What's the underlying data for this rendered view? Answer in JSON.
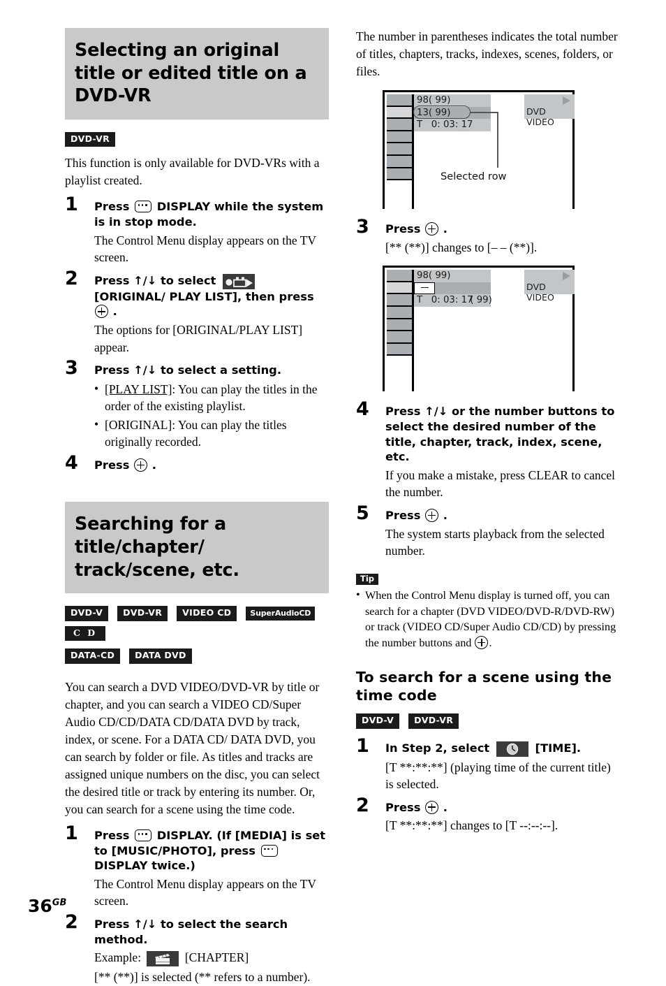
{
  "page": {
    "folio_number": "36",
    "folio_suffix": "GB"
  },
  "left_column": {
    "heading1": "Selecting an original title or edited title on a DVD-VR",
    "badges1": [
      {
        "label": "DVD-VR",
        "style": "plain"
      }
    ],
    "intro1": "This function is only available for DVD-VRs with a playlist created.",
    "steps1": [
      {
        "num": "1",
        "title_pre": "Press",
        "title_post": "DISPLAY while the system is in stop mode.",
        "body": "The Control Menu display appears on the TV screen."
      },
      {
        "num": "2",
        "title_pre": "Press ↑/↓ to select",
        "title_mid": "[ORIGINAL/ PLAY LIST], then press",
        "title_post": ".",
        "body": "The options for [ORIGINAL/PLAY LIST] appear."
      },
      {
        "num": "3",
        "title": "Press ↑/↓ to select a setting.",
        "bullets": [
          {
            "term": "[PLAY LIST]",
            "underlined": true,
            "text": ": You can play the titles in the order of the existing playlist."
          },
          {
            "term": "[ORIGINAL]",
            "underlined": false,
            "text": ": You can play the titles originally recorded."
          }
        ]
      },
      {
        "num": "4",
        "title_pre": "Press",
        "title_post": "."
      }
    ],
    "heading2": "Searching for a title/chapter/ track/scene, etc.",
    "badges2_row1": [
      {
        "label": "DVD-V",
        "style": "plain"
      },
      {
        "label": "DVD-VR",
        "style": "plain"
      },
      {
        "label": "VIDEO CD",
        "style": "plain"
      },
      {
        "label": "SuperAudioCD",
        "style": "sacd"
      },
      {
        "label": "C D",
        "style": "cdlogo"
      }
    ],
    "badges2_row2": [
      {
        "label": "DATA-CD",
        "style": "plain"
      },
      {
        "label": "DATA DVD",
        "style": "plain"
      }
    ],
    "intro2": "You can search a DVD VIDEO/DVD-VR by title or chapter, and you can search a VIDEO CD/Super Audio CD/CD/DATA CD/DATA DVD by track, index, or scene. For a DATA CD/ DATA DVD, you can search by folder or file. As titles and tracks are assigned unique numbers on the disc, you can select the desired title or track by entering its number. Or, you can search for a scene using the time code.",
    "steps2": [
      {
        "num": "1",
        "title_pre": "Press",
        "title_mid": "DISPLAY. (If [MEDIA] is set to [MUSIC/PHOTO], press",
        "title_post": "DISPLAY twice.)",
        "body": "The Control Menu display appears on the TV screen."
      },
      {
        "num": "2",
        "title": "Press ↑/↓ to select the search method.",
        "example_label": "Example:",
        "example_value": "[CHAPTER]",
        "body": "[** (**)] is selected (** refers to a number)."
      }
    ]
  },
  "right_column": {
    "intro": "The number in parentheses indicates the total number of titles, chapters, tracks, indexes, scenes, folders, or files.",
    "screen1": {
      "icon_cells": 7,
      "selected_cell_index": 1,
      "line1": "98( 99)",
      "line2": "13( 99)",
      "line3": "T   0: 03: 17",
      "disc_label": "DVD VIDEO",
      "callout": "Selected row"
    },
    "steps": [
      {
        "num": "3",
        "title_pre": "Press",
        "title_post": ".",
        "body": "[** (**)] changes to [– – (**)]."
      },
      {
        "num": "4",
        "title": "Press ↑/↓ or the number buttons to select the desired number of the title, chapter, track, index, scene, etc.",
        "body": "If you make a mistake, press CLEAR to cancel the number."
      },
      {
        "num": "5",
        "title_pre": "Press",
        "title_post": ".",
        "body": "The system starts playback from the selected number."
      }
    ],
    "screen2": {
      "icon_cells": 7,
      "selected_cell_index": 1,
      "line1": "98( 99)",
      "line2_dashes": "––",
      "line2_rest": "( 99)",
      "line3": "T   0: 03: 17",
      "disc_label": "DVD VIDEO"
    },
    "tip": {
      "badge": "Tip",
      "items": [
        "When the Control Menu display is turned off, you can search for a chapter (DVD VIDEO/DVD-R/DVD-RW) or track (VIDEO CD/Super Audio CD/CD) by pressing the number buttons and"
      ],
      "trailing": "."
    },
    "subheading": "To search for a scene using the time code",
    "badges": [
      {
        "label": "DVD-V",
        "style": "plain"
      },
      {
        "label": "DVD-VR",
        "style": "plain"
      }
    ],
    "time_steps": [
      {
        "num": "1",
        "title_pre": "In Step 2, select",
        "title_post": "[TIME].",
        "body": "[T **:**:**] (playing time of the current title) is selected."
      },
      {
        "num": "2",
        "title_pre": "Press",
        "title_post": ".",
        "body": "[T **:**:**] changes to [T --:--:--]."
      }
    ]
  }
}
